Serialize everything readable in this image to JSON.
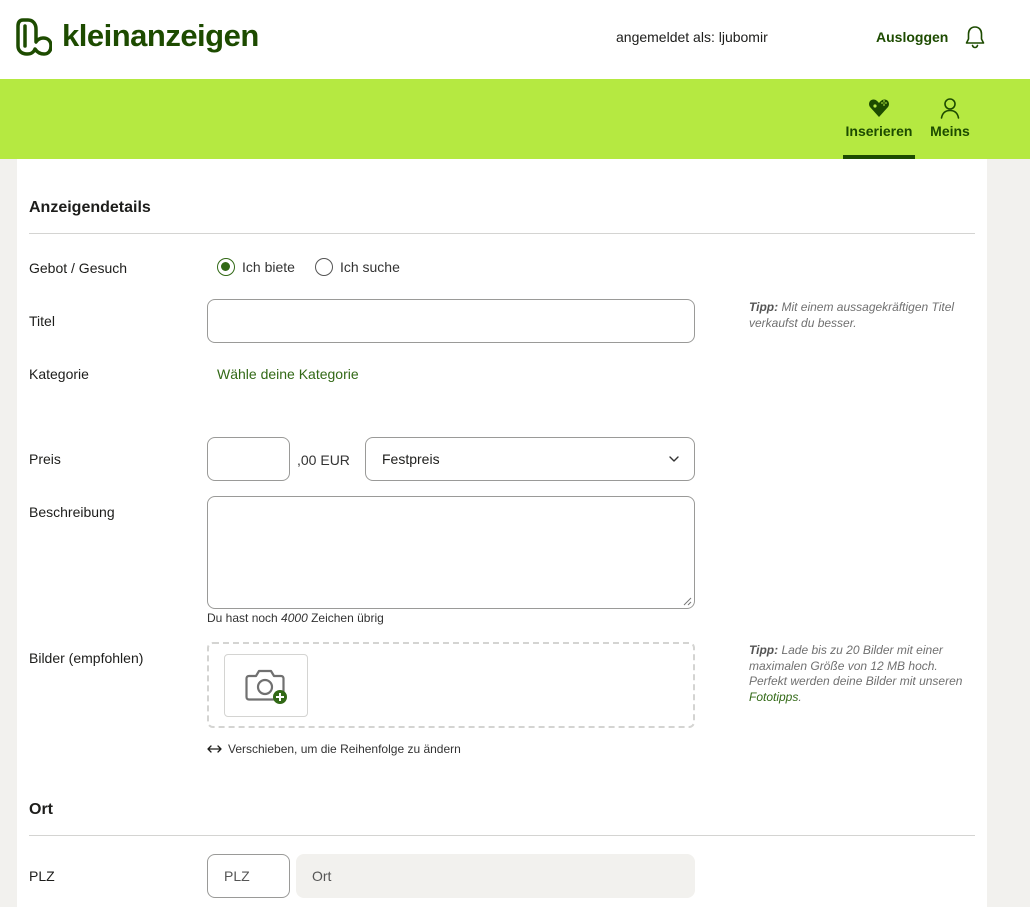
{
  "header": {
    "logo_text": "kleinanzeigen",
    "login_info": "angemeldet als: ljubomir",
    "logout_label": "Ausloggen"
  },
  "nav": {
    "items": [
      {
        "label": "Inserieren",
        "icon": "tag-add-icon",
        "active": true
      },
      {
        "label": "Meins",
        "icon": "user-icon",
        "active": false
      }
    ]
  },
  "colors": {
    "brand_dark": "#1d4b00",
    "brand_green": "#326916",
    "nav_bg": "#b5e941",
    "page_bg": "#f2f1ee"
  },
  "form": {
    "details_title": "Anzeigendetails",
    "offer_type": {
      "label": "Gebot / Gesuch",
      "options": [
        "Ich biete",
        "Ich suche"
      ],
      "selected": "Ich biete"
    },
    "title": {
      "label": "Titel",
      "value": "",
      "tip_bold": "Tipp:",
      "tip_text": " Mit einem aussagekräftigen Titel verkaufst du besser."
    },
    "category": {
      "label": "Kategorie",
      "link": "Wähle deine Kategorie"
    },
    "price": {
      "label": "Preis",
      "value": "",
      "suffix": ",00 EUR",
      "type_selected": "Festpreis"
    },
    "description": {
      "label": "Beschreibung",
      "value": "",
      "remaining_prefix": "Du hast noch ",
      "remaining_count": "4000",
      "remaining_suffix": " Zeichen übrig"
    },
    "images": {
      "label": "Bilder (empfohlen)",
      "reorder_hint": "Verschieben, um die Reihenfolge zu ändern",
      "tip_bold": "Tipp:",
      "tip_text": " Lade bis zu 20 Bilder mit einer maximalen Größe von 12 MB hoch. Perfekt werden deine Bilder mit unseren ",
      "tip_link": "Fototipps",
      "tip_end": "."
    },
    "location_title": "Ort",
    "plz": {
      "label": "PLZ",
      "placeholder": "PLZ",
      "ort_placeholder": "Ort"
    }
  }
}
